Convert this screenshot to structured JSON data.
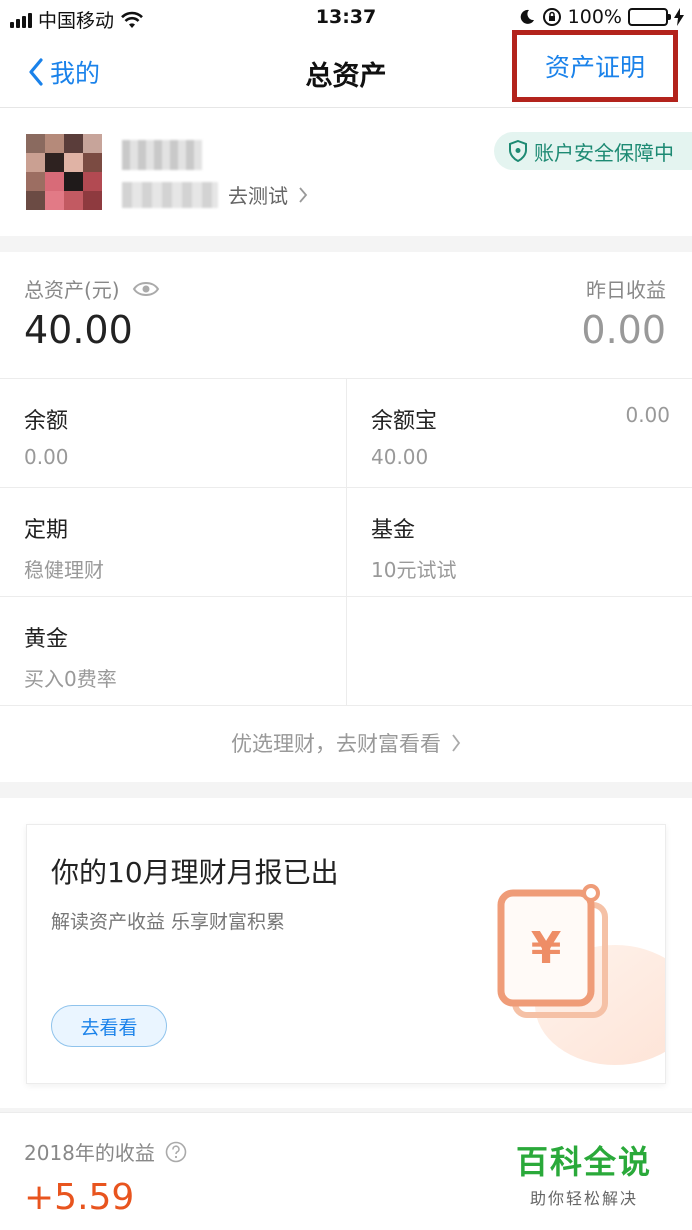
{
  "status_bar": {
    "carrier": "中国移动",
    "time": "13:37",
    "battery": "100%",
    "battery_level": 1.0
  },
  "nav": {
    "back_label": "我的",
    "title": "总资产",
    "right_action": "资产证明"
  },
  "profile": {
    "test_link": "去测试",
    "security_badge": "账户安全保障中"
  },
  "assets": {
    "total_label": "总资产(元)",
    "total_value": "40.00",
    "yesterday_label": "昨日收益",
    "yesterday_value": "0.00",
    "items": [
      {
        "title": "余额",
        "subtitle": "0.00",
        "extra": ""
      },
      {
        "title": "余额宝",
        "subtitle": "40.00",
        "extra": "0.00"
      },
      {
        "title": "定期",
        "subtitle": "稳健理财",
        "extra": ""
      },
      {
        "title": "基金",
        "subtitle": "10元试试",
        "extra": ""
      },
      {
        "title": "黄金",
        "subtitle": "买入0费率",
        "extra": ""
      }
    ],
    "more_link": "优选理财，去财富看看"
  },
  "report": {
    "title": "你的10月理财月报已出",
    "subtitle": "解读资产收益 乐享财富积累",
    "button": "去看看",
    "art_symbol": "¥"
  },
  "earnings": {
    "label": "2018年的收益",
    "value": "+5.59"
  },
  "watermark": {
    "title": "百科全说",
    "subtitle": "助你轻松解决"
  },
  "colors": {
    "accent": "#1a82ea",
    "highlight_box": "#b3231c",
    "security_green": "#1d8a73",
    "earnings_orange": "#e8541e",
    "battery_green": "#35c759"
  }
}
